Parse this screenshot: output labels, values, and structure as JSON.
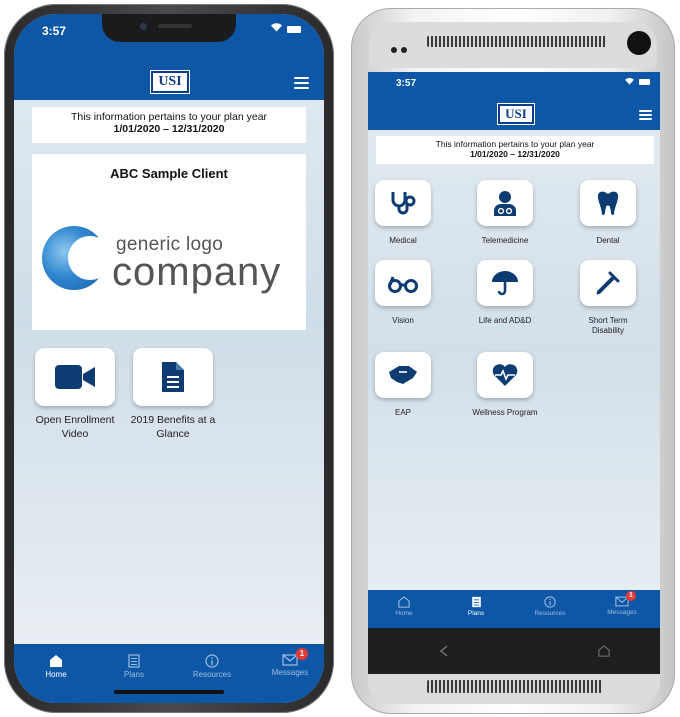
{
  "colors": {
    "brand_blue": "#0d57a6",
    "white": "#ffffff",
    "badge_red": "#e53935"
  },
  "iphone": {
    "status": {
      "time": "3:57"
    },
    "header": {
      "logo": "USI",
      "menu_icon": "hamburger-menu-icon"
    },
    "plan_notice": {
      "line1": "This information pertains to your plan year",
      "line2": "1/01/2020 – 12/31/2020"
    },
    "client": {
      "name": "ABC Sample Client",
      "logo_line1": "generic logo",
      "logo_line2": "company"
    },
    "tiles": [
      {
        "icon": "video-camera-icon",
        "label_line1": "Open Enrollment",
        "label_line2": "Video"
      },
      {
        "icon": "document-icon",
        "label_line1": "2019 Benefits at a",
        "label_line2": "Glance"
      }
    ],
    "tabs": [
      {
        "icon": "home-icon",
        "label": "Home",
        "active": true
      },
      {
        "icon": "plans-icon",
        "label": "Plans",
        "active": false
      },
      {
        "icon": "info-icon",
        "label": "Resources",
        "active": false
      },
      {
        "icon": "mail-icon",
        "label": "Messages",
        "active": false,
        "badge": "1"
      }
    ]
  },
  "android": {
    "status": {
      "time": "3:57"
    },
    "header": {
      "logo": "USI",
      "menu_icon": "hamburger-menu-icon"
    },
    "plan_notice": {
      "line1": "This information pertains to your plan year",
      "line2": "1/01/2020 – 12/31/2020"
    },
    "tiles": [
      {
        "icon": "stethoscope-icon",
        "label_line1": "Medical",
        "label_line2": ""
      },
      {
        "icon": "doctor-icon",
        "label_line1": "Telemedicine",
        "label_line2": ""
      },
      {
        "icon": "tooth-icon",
        "label_line1": "Dental",
        "label_line2": ""
      },
      {
        "icon": "glasses-icon",
        "label_line1": "Vision",
        "label_line2": ""
      },
      {
        "icon": "umbrella-icon",
        "label_line1": "Life and AD&D",
        "label_line2": ""
      },
      {
        "icon": "crutch-icon",
        "label_line1": "Short Term",
        "label_line2": "Disability"
      },
      {
        "icon": "handshake-icon",
        "label_line1": "EAP",
        "label_line2": ""
      },
      {
        "icon": "heartbeat-icon",
        "label_line1": "Wellness Program",
        "label_line2": ""
      }
    ],
    "tabs": [
      {
        "icon": "home-icon",
        "label": "Home",
        "active": false
      },
      {
        "icon": "plans-icon",
        "label": "Plans",
        "active": true
      },
      {
        "icon": "info-icon",
        "label": "Resources",
        "active": false
      },
      {
        "icon": "mail-icon",
        "label": "Messages",
        "active": false,
        "badge": "1"
      }
    ],
    "system_nav": {
      "back_icon": "back-icon",
      "home_icon": "home-outline-icon"
    }
  }
}
